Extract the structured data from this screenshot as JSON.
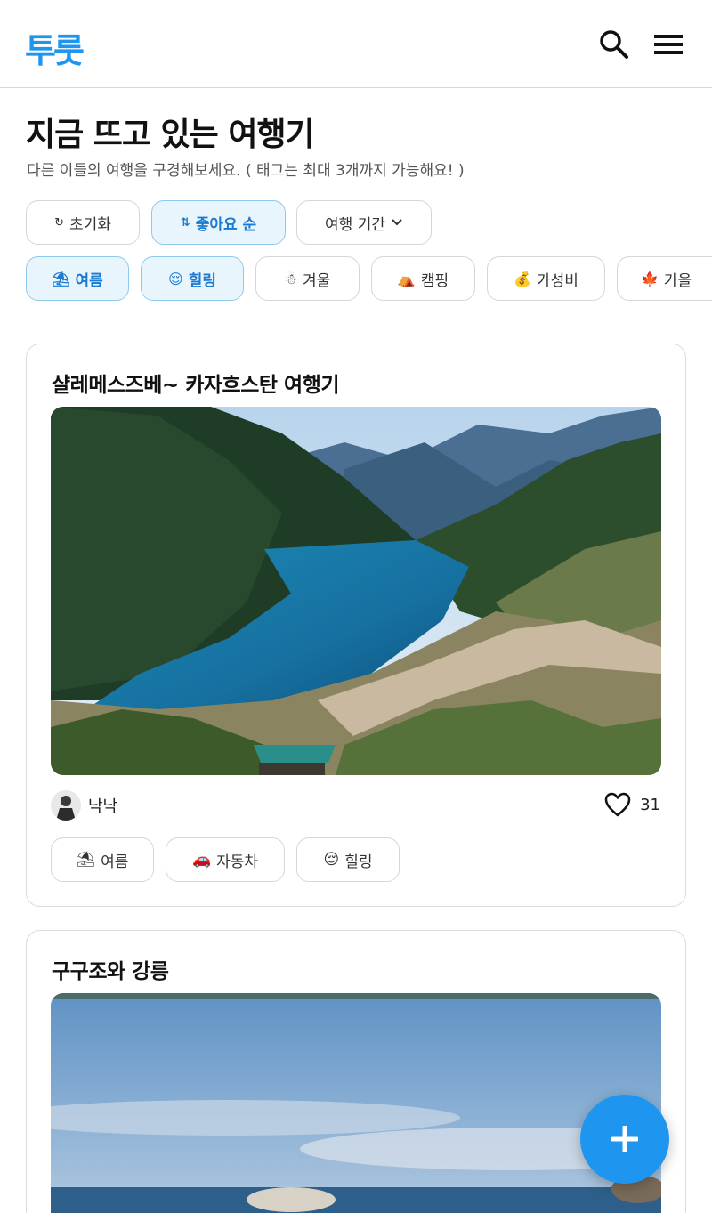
{
  "header": {
    "logo": "투룻",
    "search_icon": "search-icon",
    "menu_icon": "hamburger-menu-icon"
  },
  "page": {
    "title": "지금 뜨고 있는 여행기",
    "subtitle": "다른 이들의 여행을 구경해보세요. ( 태그는 최대 3개까지 가능해요! )"
  },
  "filters": {
    "reset": {
      "icon": "↻",
      "label": "초기화"
    },
    "sort": {
      "icon": "⇅",
      "label": "좋아요 순"
    },
    "period": {
      "label": "여행 기간",
      "icon": "chevron-down-icon"
    }
  },
  "tags": [
    {
      "emoji": "⛱",
      "label": "여름",
      "active": true
    },
    {
      "emoji": "😌",
      "label": "힐링",
      "active": true
    },
    {
      "emoji": "☃",
      "label": "겨울",
      "active": false
    },
    {
      "emoji": "⛺",
      "label": "캠핑",
      "active": false
    },
    {
      "emoji": "💰",
      "label": "가성비",
      "active": false
    },
    {
      "emoji": "🍁",
      "label": "가을",
      "active": false
    }
  ],
  "posts": [
    {
      "title": "샬레메스즈베~ 카자흐스탄 여행기",
      "image": "mountain-lake-photo",
      "author": "낙낙",
      "likes": "31",
      "tags": [
        {
          "emoji": "⛱",
          "label": "여름"
        },
        {
          "emoji": "🚗",
          "label": "자동차"
        },
        {
          "emoji": "😌",
          "label": "힐링"
        }
      ]
    },
    {
      "title": "구구조와 강릉",
      "image": "beach-sky-photo"
    }
  ],
  "fab": {
    "icon": "plus-icon"
  },
  "colors": {
    "accent": "#1e96f0",
    "active_bg": "#e9f5fd",
    "active_border": "#8cc9ef"
  }
}
